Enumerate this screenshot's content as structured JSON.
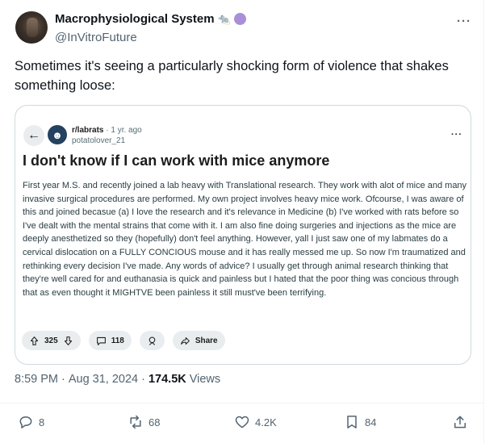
{
  "author": {
    "display_name": "Macrophysiological System",
    "badge_emoji": "🐀",
    "handle": "@InVitroFuture"
  },
  "tweet": {
    "text": "Sometimes it's seeing a particularly shocking form of violence that shakes something loose:"
  },
  "card": {
    "subreddit": "r/labrats",
    "separator": "·",
    "age": "1 yr. ago",
    "username": "potatolover_21",
    "title": "I don't know if I can work with mice anymore",
    "body": "First year M.S. and recently joined a lab heavy with Translational research. They work with alot of mice and many invasive surgical procedures are performed. My own project involves heavy mice work. Ofcourse, I was aware of this and joined becasue (a) I love the research and it's relevance in Medicine (b) I've worked with rats before so I've dealt with the mental strains that come with it. I am also fine doing surgeries and injections as the mice are deeply anesthetized so they (hopefully) don't feel anything. However, yall I just saw one of my labmates do a cervical dislocation on a FULLY CONCIOUS mouse and it has really messed me up. So now I'm traumatized and rethinking every decision I've made. Any words of advice? I usually get through animal research thinking that they're well cared for and euthanasia is quick and painless but I hated that the poor thing was concious through that as even thought it MIGHTVE been painless it still must've been terrifying.",
    "votes": "325",
    "comments": "118",
    "share_label": "Share"
  },
  "meta": {
    "time": "8:59 PM",
    "dot": "·",
    "date": "Aug 31, 2024",
    "views_count": "174.5K",
    "views_label": "Views"
  },
  "stats": {
    "replies": "8",
    "reposts": "68",
    "likes": "4.2K",
    "bookmarks": "84"
  },
  "colors": {
    "accent_purple": "#a98fd7",
    "muted": "#536471",
    "card_border": "#cfd9de",
    "pill_bg": "#eaedef"
  }
}
